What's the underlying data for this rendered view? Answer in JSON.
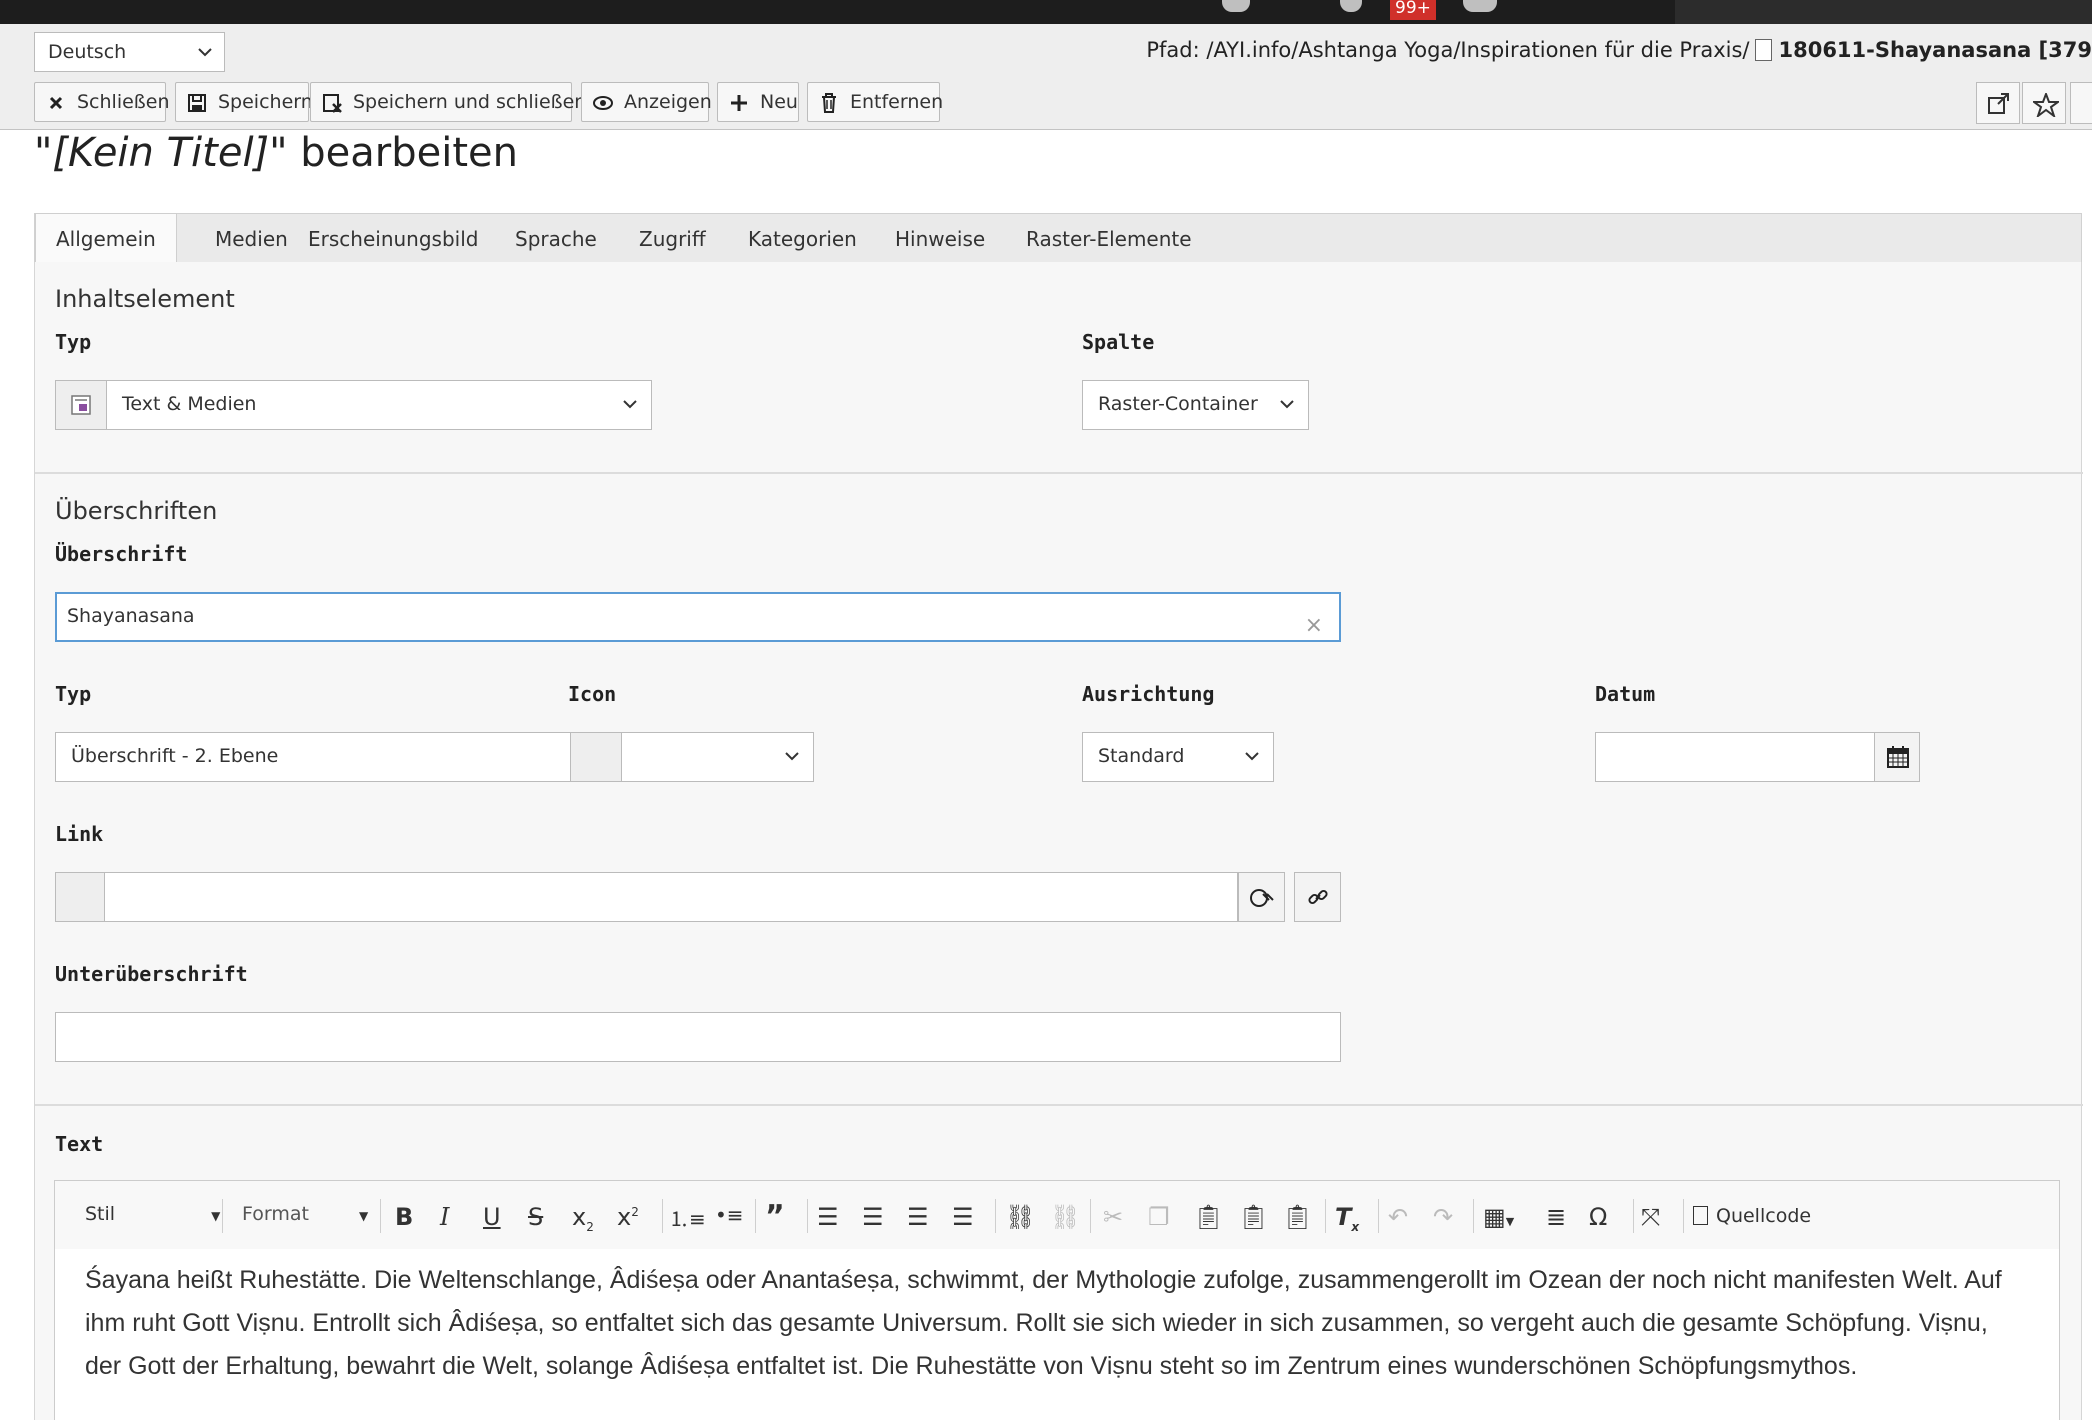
{
  "os_bar": {
    "notification_badge": "99+"
  },
  "docheader": {
    "language_select": "Deutsch",
    "path_label": "Pfad: /AYI.info/Ashtanga Yoga/Inspirationen für die Praxis/",
    "path_page": "180611-Shayanasana [379",
    "toolbar": {
      "close": "Schließen",
      "save": "Speichern",
      "save_close": "Speichern und schließen",
      "view": "Anzeigen",
      "new": "Neu",
      "delete": "Entfernen"
    }
  },
  "page_title": {
    "open_quote": "\"",
    "italic": "[Kein Titel]",
    "suffix": "\" bearbeiten"
  },
  "tabs": [
    "Allgemein",
    "Medien",
    "Erscheinungsbild",
    "Sprache",
    "Zugriff",
    "Kategorien",
    "Hinweise",
    "Raster-Elemente"
  ],
  "content_element": {
    "section_title": "Inhaltselement",
    "type_label": "Typ",
    "type_value": "Text & Medien",
    "column_label": "Spalte",
    "column_value": "Raster-Container"
  },
  "headers": {
    "section_title": "Überschriften",
    "header_label": "Überschrift",
    "header_value": "Shayanasana",
    "type_label": "Typ",
    "type_value": "Überschrift - 2. Ebene",
    "icon_label": "Icon",
    "icon_value": "",
    "align_label": "Ausrichtung",
    "align_value": "Standard",
    "date_label": "Datum",
    "date_value": "",
    "link_label": "Link",
    "link_value": "",
    "subheader_label": "Unterüberschrift",
    "subheader_value": ""
  },
  "text": {
    "label": "Text",
    "toolbar": {
      "style": "Stil",
      "format": "Format",
      "source": "Quellcode"
    },
    "body": "Śayana heißt Ruhestätte. Die Weltenschlange, Âdiśeṣa oder Anantaśeṣa, schwimmt, der Mythologie zufolge, zusammengerollt im Ozean der noch nicht manifesten Welt. Auf ihm ruht Gott Viṣnu. Entrollt sich Âdiśeṣa, so entfaltet sich das gesamte Universum. Rollt sie sich wieder in sich zusammen, so vergeht auch die gesamte Schöpfung. Viṣnu, der Gott der Erhaltung, bewahrt die Welt, solange Âdiśeṣa entfaltet ist. Die Ruhestätte von Viṣnu steht so im Zentrum eines wunderschönen Schöpfungsmythos."
  }
}
